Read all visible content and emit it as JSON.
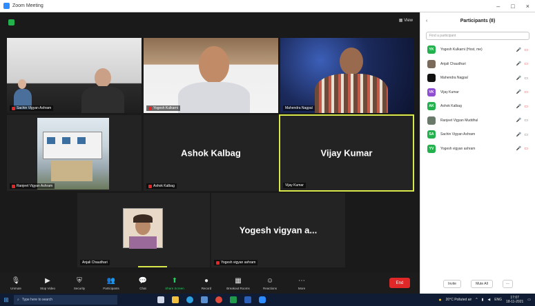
{
  "window": {
    "title": "Zoom Meeting",
    "controls": [
      "–",
      "□",
      "×"
    ]
  },
  "meeting": {
    "view_label": "View",
    "tiles": [
      {
        "name": "Sachin Vigyan Ashram",
        "type": "video",
        "muted": true
      },
      {
        "name": "Yogesh Kulkarni",
        "type": "video",
        "muted": true
      },
      {
        "name": "Mahendra Nagpal",
        "type": "video",
        "muted": false
      },
      {
        "name": "Ranjeet Vigyan Ashram",
        "type": "video",
        "muted": true
      },
      {
        "name": "Ashok Kalbag",
        "type": "name",
        "muted": true
      },
      {
        "name": "Vijay Kumar",
        "type": "name",
        "muted": false,
        "active_speaker": true
      },
      {
        "name": "Anjali Chaudhari",
        "type": "photo",
        "muted": false
      },
      {
        "name": "Yogesh vigyan a...",
        "footer_name": "Yogesh vigyan ashram",
        "type": "name",
        "muted": true
      }
    ]
  },
  "toolbar": {
    "items": [
      {
        "icon": "🎙",
        "label": "Unmute",
        "icon_name": "mic-icon"
      },
      {
        "icon": "▶",
        "label": "Stop Video",
        "icon_name": "video-icon"
      },
      {
        "icon": "⛨",
        "label": "Security",
        "icon_name": "security-icon"
      },
      {
        "icon": "👥",
        "label": "Participants",
        "icon_name": "participants-icon"
      },
      {
        "icon": "💬",
        "label": "Chat",
        "icon_name": "chat-icon"
      },
      {
        "icon": "⬆",
        "label": "Share Screen",
        "icon_name": "share-screen-icon",
        "green": true
      },
      {
        "icon": "●",
        "label": "Record",
        "icon_name": "record-icon"
      },
      {
        "icon": "▦",
        "label": "Breakout Rooms",
        "icon_name": "breakout-rooms-icon"
      },
      {
        "icon": "☺",
        "label": "Reactions",
        "icon_name": "reactions-icon"
      },
      {
        "icon": "⋯",
        "label": "More",
        "icon_name": "more-icon"
      }
    ],
    "end_label": "End"
  },
  "participants_panel": {
    "title": "Participants (8)",
    "search_placeholder": "Find a participant",
    "participants": [
      {
        "initials": "YK",
        "name": "Yogesh Kulkarni (Host, me)",
        "color": "#23b14d",
        "mic_on": false
      },
      {
        "initials": "",
        "name": "Anjali Chaudhari",
        "color": "#7a6a5a",
        "mic_on": true
      },
      {
        "initials": "",
        "name": "Mahendra Nagpal",
        "color": "#111111",
        "mic_on": true
      },
      {
        "initials": "VK",
        "name": "Vijay Kumar",
        "color": "#8e4fd0",
        "mic_on": true
      },
      {
        "initials": "AK",
        "name": "Ashok Kalbag",
        "color": "#23b14d",
        "mic_on": false
      },
      {
        "initials": "",
        "name": "Ranjeet Vigyan Muddhul",
        "color": "#6a7a6a",
        "mic_on": false
      },
      {
        "initials": "SA",
        "name": "Sachin Vigyan Ashram",
        "color": "#23b14d",
        "mic_on": false
      },
      {
        "initials": "YV",
        "name": "Yogesh vigyan ashram",
        "color": "#23b14d",
        "mic_on": false
      }
    ],
    "invite_label": "Invite",
    "mute_all_label": "Mute All",
    "more_label": "..."
  },
  "taskbar": {
    "search_placeholder": "Type here to search",
    "weather": "20°C Polluted air",
    "language": "ENG",
    "time": "17:07",
    "date": "18-11-2021",
    "apps": [
      {
        "name": "task-view-icon",
        "color": "#d0d8e8"
      },
      {
        "name": "file-explorer-icon",
        "color": "#f0c040"
      },
      {
        "name": "edge-icon",
        "color": "#2fa0e0"
      },
      {
        "name": "store-icon",
        "color": "#5a8fd0"
      },
      {
        "name": "chrome-icon",
        "color": "#e04a3a"
      },
      {
        "name": "excel-icon",
        "color": "#1f9a4a"
      },
      {
        "name": "word-icon",
        "color": "#2b5fb8"
      },
      {
        "name": "zoom-app-icon",
        "color": "#2d8cff"
      }
    ]
  }
}
